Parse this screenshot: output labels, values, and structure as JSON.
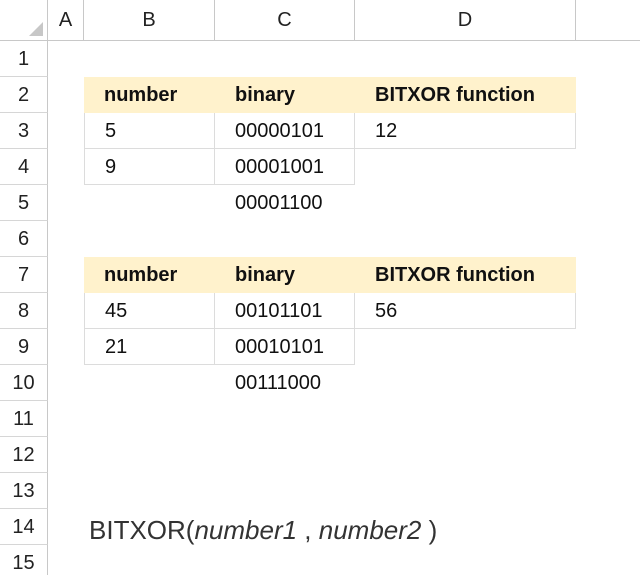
{
  "columns": [
    "A",
    "B",
    "C",
    "D"
  ],
  "rows": [
    "1",
    "2",
    "3",
    "4",
    "5",
    "6",
    "7",
    "8",
    "9",
    "10",
    "11",
    "12",
    "13",
    "14",
    "15"
  ],
  "table1": {
    "header": {
      "number": "number",
      "binary": "binary",
      "fn": "BITXOR function"
    },
    "rows": [
      {
        "number": "5",
        "binary": "00000101",
        "fn": "12"
      },
      {
        "number": "9",
        "binary": "00001001",
        "fn": ""
      }
    ],
    "result_binary": "00001100"
  },
  "table2": {
    "header": {
      "number": "number",
      "binary": "binary",
      "fn": "BITXOR function"
    },
    "rows": [
      {
        "number": "45",
        "binary": "00101101",
        "fn": "56"
      },
      {
        "number": "21",
        "binary": "00010101",
        "fn": ""
      }
    ],
    "result_binary": "00111000"
  },
  "syntax": {
    "fn_name": "BITXOR(",
    "arg1": "number1",
    "sep": " , ",
    "arg2": "number2",
    "close": " )"
  }
}
